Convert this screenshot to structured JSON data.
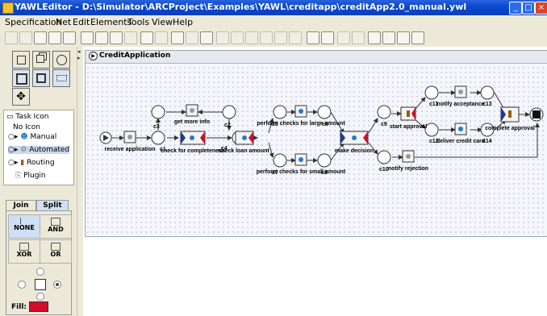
{
  "window": {
    "title": "YAWLEditor - D:\\Simulator\\ARCProject\\Examples\\YAWL\\creditapp\\creditApp2.0_manual.ywl"
  },
  "menu": [
    "Specification",
    "Net",
    "Edit",
    "Elements",
    "Tools",
    "View",
    "Help"
  ],
  "net": {
    "title": "CreditApplication",
    "tasks": [
      {
        "id": "receive",
        "label": "receive application",
        "kind": "automated"
      },
      {
        "id": "getmore",
        "label": "get more info",
        "kind": "automated"
      },
      {
        "id": "checkcomp",
        "label": "check for completeness",
        "kind": "manual"
      },
      {
        "id": "checkloan",
        "label": "check loan amount",
        "kind": "manual"
      },
      {
        "id": "perflarge",
        "label": "perform checks for large amount",
        "kind": "manual"
      },
      {
        "id": "perfsmall",
        "label": "perform checks for small amount",
        "kind": "manual"
      },
      {
        "id": "makedec",
        "label": "make decision",
        "kind": "manual"
      },
      {
        "id": "startapp",
        "label": "start approval",
        "kind": "routing"
      },
      {
        "id": "notifyacc",
        "label": "notify acceptance",
        "kind": "automated"
      },
      {
        "id": "delivercard",
        "label": "deliver credit card",
        "kind": "manual"
      },
      {
        "id": "completeapp",
        "label": "complete approval",
        "kind": "routing"
      },
      {
        "id": "notifyrej",
        "label": "notify rejection",
        "kind": "automated"
      }
    ],
    "conditions": [
      "c1",
      "c2",
      "c3",
      "c4",
      "c5",
      "c6",
      "c7",
      "c8",
      "c9",
      "c10",
      "c11",
      "c12",
      "c13",
      "c14"
    ]
  },
  "tree": {
    "root": "Task Icon",
    "items": [
      {
        "label": "No Icon"
      },
      {
        "label": "Manual"
      },
      {
        "label": "Automated",
        "selected": true
      },
      {
        "label": "Routing"
      },
      {
        "label": "Plugin"
      }
    ]
  },
  "decorator": {
    "tabs": [
      "Join",
      "Split"
    ],
    "active_tab": "Split",
    "types": [
      "NONE",
      "AND",
      "XOR",
      "OR"
    ],
    "selected_type": "NONE",
    "fill_label": "Fill:",
    "fill_color": "#d0102a"
  }
}
